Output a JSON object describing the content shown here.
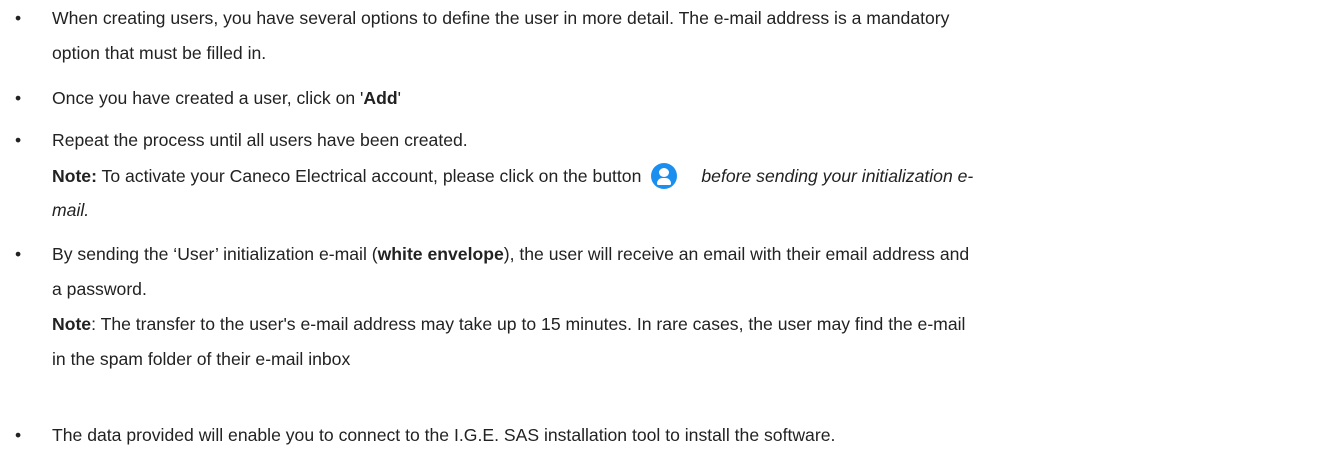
{
  "bullets": [
    {
      "line1": "When creating users, you have several options to define the user in more detail. The e-mail address is a mandatory",
      "line2": "option that must be filled in."
    },
    {
      "pre": "Once you have created a user, click on '",
      "bold": "Add",
      "post": "'"
    },
    {
      "line1": "Repeat the process until all users have been created.",
      "note_label": "Note:",
      "note_text": " To activate your Caneco Electrical account, please click on the button",
      "note_italic": "before sending your initialization e-",
      "note_italic_line2": "mail.",
      "icon": "user-account-icon",
      "icon_color": "#1a8ff0"
    },
    {
      "pre": "By sending the ‘User’ initialization e-mail (",
      "bold": "white envelope",
      "post": "), the user will receive an email with their email address and",
      "line2": "a password.",
      "note_label": "Note",
      "note_text": ": The transfer to the user's e-mail address may take up to 15 minutes. In rare cases, the user may find the e-mail",
      "note_line2": "in the spam folder of their e-mail inbox"
    },
    {
      "line1": "The data provided will enable you to connect to the I.G.E. SAS installation tool to install the software."
    }
  ],
  "bullet_glyph": "•"
}
